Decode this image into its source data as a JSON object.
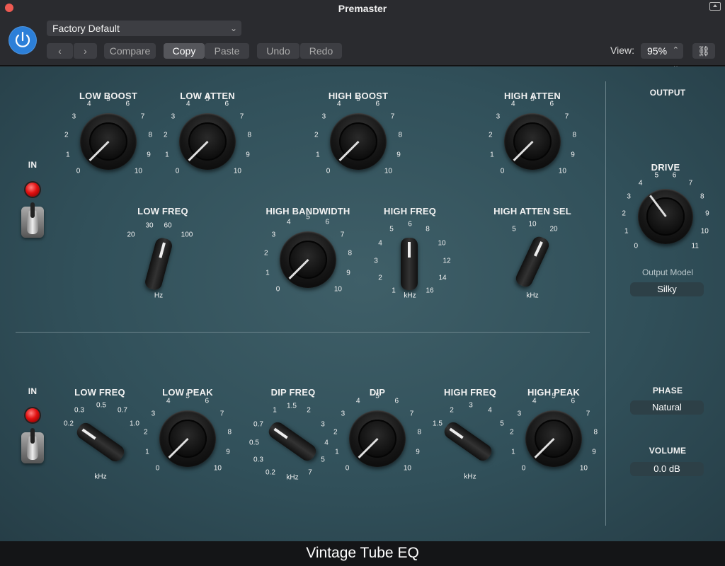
{
  "window": {
    "title": "Premaster",
    "footer_title": "Vintage Tube EQ"
  },
  "toolbar": {
    "preset": "Factory Default",
    "compare": "Compare",
    "copy": "Copy",
    "paste": "Paste",
    "undo": "Undo",
    "redo": "Redo",
    "view_label": "View:",
    "view_value": "95%"
  },
  "knobs": [
    {
      "id": "low-boost",
      "label": "LOW BOOST",
      "ticks": [
        "0",
        "1",
        "2",
        "3",
        "4",
        "5",
        "6",
        "7",
        "8",
        "9",
        "10"
      ],
      "value": 0
    },
    {
      "id": "low-atten",
      "label": "LOW ATTEN",
      "ticks": [
        "0",
        "1",
        "2",
        "3",
        "4",
        "5",
        "6",
        "7",
        "8",
        "9",
        "10"
      ],
      "value": 0
    },
    {
      "id": "high-boost",
      "label": "HIGH BOOST",
      "ticks": [
        "0",
        "1",
        "2",
        "3",
        "4",
        "5",
        "6",
        "7",
        "8",
        "9",
        "10"
      ],
      "value": 0
    },
    {
      "id": "high-atten",
      "label": "HIGH ATTEN",
      "ticks": [
        "0",
        "1",
        "2",
        "3",
        "4",
        "5",
        "6",
        "7",
        "8",
        "9",
        "10"
      ],
      "value": 0
    },
    {
      "id": "high-bandwidth",
      "label": "HIGH BANDWIDTH",
      "ticks": [
        "0",
        "1",
        "2",
        "3",
        "4",
        "5",
        "6",
        "7",
        "8",
        "9",
        "10"
      ],
      "value": 0
    },
    {
      "id": "drive",
      "label": "DRIVE",
      "ticks": [
        "0",
        "1",
        "2",
        "3",
        "4",
        "5",
        "6",
        "7",
        "8",
        "9",
        "10",
        "11"
      ],
      "value": 4
    },
    {
      "id": "low-peak",
      "label": "LOW PEAK",
      "ticks": [
        "0",
        "1",
        "2",
        "3",
        "4",
        "5",
        "6",
        "7",
        "8",
        "9",
        "10"
      ],
      "value": 0
    },
    {
      "id": "dip",
      "label": "DIP",
      "ticks": [
        "0",
        "1",
        "2",
        "3",
        "4",
        "5",
        "6",
        "7",
        "8",
        "9",
        "10"
      ],
      "value": 0
    },
    {
      "id": "high-peak",
      "label": "HIGH PEAK",
      "ticks": [
        "0",
        "1",
        "2",
        "3",
        "4",
        "5",
        "6",
        "7",
        "8",
        "9",
        "10"
      ],
      "value": 0
    }
  ],
  "selectors": [
    {
      "id": "low-freq-top",
      "label": "LOW FREQ",
      "ticks": [
        "20",
        "30",
        "60",
        "100"
      ],
      "unit": "Hz",
      "value": "60"
    },
    {
      "id": "high-freq-top",
      "label": "HIGH FREQ",
      "ticks": [
        "1",
        "2",
        "3",
        "4",
        "5",
        "6",
        "8",
        "10",
        "12",
        "14",
        "16"
      ],
      "unit": "kHz",
      "value": "6"
    },
    {
      "id": "high-atten-sel",
      "label": "HIGH ATTEN SEL",
      "ticks": [
        "5",
        "10",
        "20"
      ],
      "unit": "kHz",
      "value": "20"
    },
    {
      "id": "low-freq-bottom",
      "label": "LOW FREQ",
      "ticks": [
        "0.2",
        "0.3",
        "0.5",
        "0.7",
        "1.0"
      ],
      "unit": "kHz",
      "value": "0.2"
    },
    {
      "id": "dip-freq",
      "label": "DIP FREQ",
      "ticks": [
        "0.2",
        "0.3",
        "0.5",
        "0.7",
        "1",
        "1.5",
        "2",
        "3",
        "4",
        "5",
        "7"
      ],
      "unit": "kHz",
      "value": "0.7"
    },
    {
      "id": "high-freq-bottom",
      "label": "HIGH FREQ",
      "ticks": [
        "1.5",
        "2",
        "3",
        "4",
        "5"
      ],
      "unit": "kHz",
      "value": "1.5"
    }
  ],
  "in_top": "IN",
  "in_bottom": "IN",
  "output": {
    "title": "OUTPUT",
    "model_label": "Output Model",
    "model_value": "Silky",
    "phase_label": "PHASE",
    "phase_value": "Natural",
    "volume_label": "VOLUME",
    "volume_value": "0.0 dB"
  }
}
